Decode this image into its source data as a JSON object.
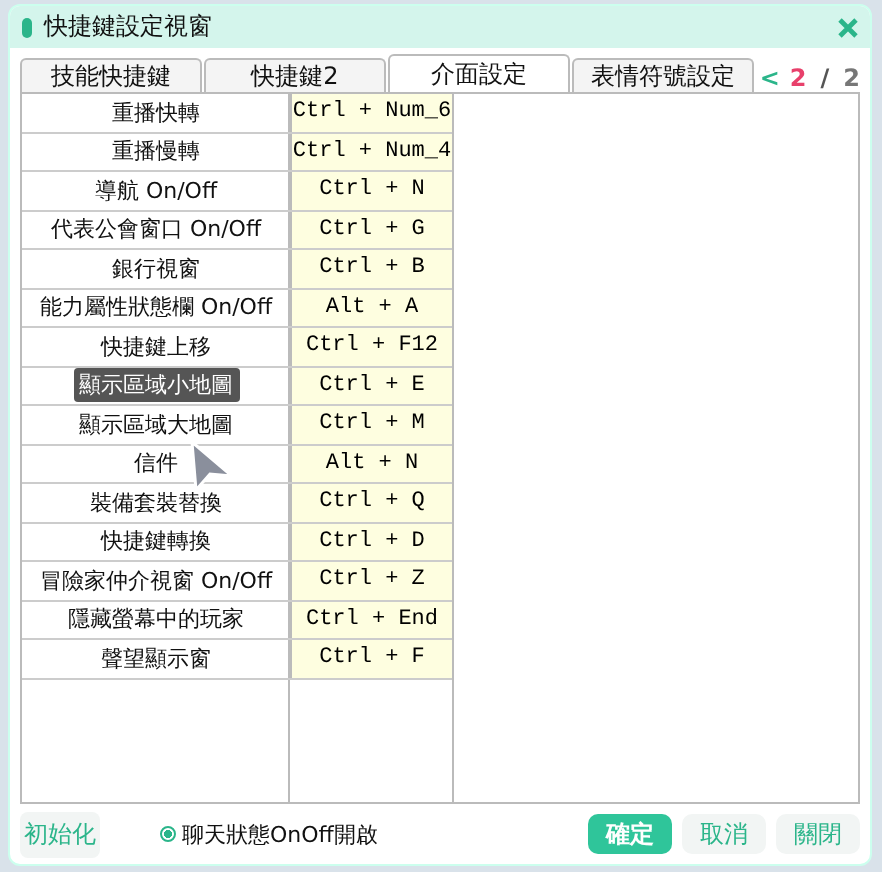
{
  "window": {
    "title": "快捷鍵設定視窗"
  },
  "tabs": [
    {
      "label": "技能快捷鍵",
      "selected": false
    },
    {
      "label": "快捷鍵2",
      "selected": false
    },
    {
      "label": "介面設定",
      "selected": true
    },
    {
      "label": "表情符號設定",
      "selected": false
    }
  ],
  "pager": {
    "prev": "<",
    "current": "2",
    "separator": "/",
    "total": "2"
  },
  "shortcuts": [
    {
      "action": "重播快轉",
      "key": "Ctrl + Num_6",
      "hovered": false
    },
    {
      "action": "重播慢轉",
      "key": "Ctrl + Num_4",
      "hovered": false
    },
    {
      "action": "導航 On/Off",
      "key": "Ctrl + N",
      "hovered": false
    },
    {
      "action": "代表公會窗口 On/Off",
      "key": "Ctrl + G",
      "hovered": false
    },
    {
      "action": "銀行視窗",
      "key": "Ctrl + B",
      "hovered": false
    },
    {
      "action": "能力屬性狀態欄 On/Off",
      "key": "Alt + A",
      "hovered": false
    },
    {
      "action": "快捷鍵上移",
      "key": "Ctrl + F12",
      "hovered": false
    },
    {
      "action": "顯示區域小地圖",
      "key": "Ctrl + E",
      "hovered": true
    },
    {
      "action": "顯示區域大地圖",
      "key": "Ctrl + M",
      "hovered": false
    },
    {
      "action": "信件",
      "key": "Alt + N",
      "hovered": false
    },
    {
      "action": "裝備套裝替換",
      "key": "Ctrl + Q",
      "hovered": false
    },
    {
      "action": "快捷鍵轉換",
      "key": "Ctrl + D",
      "hovered": false
    },
    {
      "action": "冒險家仲介視窗 On/Off",
      "key": "Ctrl + Z",
      "hovered": false
    },
    {
      "action": "隱藏螢幕中的玩家",
      "key": "Ctrl + End",
      "hovered": false
    },
    {
      "action": "聲望顯示窗",
      "key": "Ctrl + F",
      "hovered": false
    }
  ],
  "footer": {
    "reset": "初始化",
    "chat_toggle": {
      "label": "聊天狀態OnOff開啟",
      "checked": true
    },
    "buttons": [
      {
        "label": "確定",
        "primary": true
      },
      {
        "label": "取消",
        "primary": false
      },
      {
        "label": "關閉",
        "primary": false
      }
    ]
  }
}
